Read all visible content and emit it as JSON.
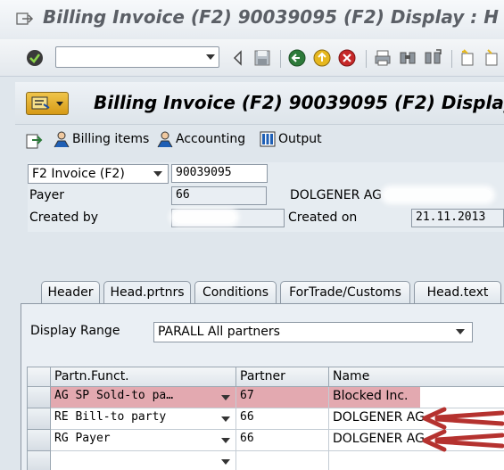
{
  "window_title": "Billing Invoice (F2) 90039095  (F2) Display : H",
  "screen_title": "Billing Invoice (F2) 90039095  (F2) Display",
  "command_field": {
    "value": ""
  },
  "app_toolbar": {
    "billing_items": "Billing items",
    "accounting": "Accounting",
    "output": "Output"
  },
  "header": {
    "doc_type": "F2 Invoice (F2)",
    "doc_number": "90039095",
    "payer_label": "Payer",
    "payer_value": "66",
    "payer_name": "DOLGENER AG",
    "created_by_label": "Created by",
    "created_on_label": "Created on",
    "created_on_value": "21.11.2013"
  },
  "tabs": [
    "Header",
    "Head.prtnrs",
    "Conditions",
    "ForTrade/Customs",
    "Head.text"
  ],
  "active_tab": "Head.prtnrs",
  "display_range": {
    "label": "Display Range",
    "value": "PARALL All partners"
  },
  "table": {
    "columns": [
      "Partn.Funct.",
      "Partner",
      "Name"
    ],
    "rows": [
      {
        "funct": "AG SP  Sold-to pa…",
        "partner": "67",
        "name": "Blocked Inc."
      },
      {
        "funct": "RE Bill-to party",
        "partner": "66",
        "name": "DOLGENER AG"
      },
      {
        "funct": "RG Payer",
        "partner": "66",
        "name": "DOLGENER AG"
      },
      {
        "funct": "",
        "partner": "",
        "name": ""
      }
    ]
  },
  "colors": {
    "highlight": "#da8c96",
    "arrow": "#b5322f",
    "sap_bg": "#dfe6ec"
  }
}
